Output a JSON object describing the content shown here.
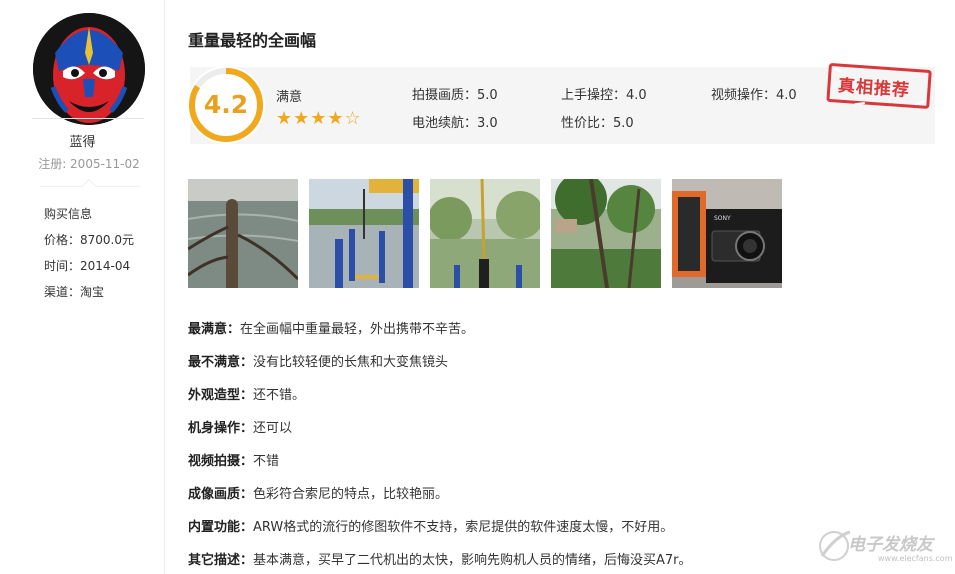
{
  "user": {
    "name": "蓝得",
    "reg_date": "注册: 2005-11-02",
    "purchase": {
      "heading": "购买信息",
      "price": "价格：8700.0元",
      "time": "时间：2014-04",
      "channel": "渠道：淘宝"
    }
  },
  "review": {
    "title": "重量最轻的全画幅",
    "score": "4.2",
    "score_value": 4.2,
    "score_max": 5,
    "satisfaction": "满意",
    "stars": "★★★★☆",
    "stars_filled": 4,
    "stars_total": 5,
    "metrics": [
      {
        "label": "拍摄画质：5.0"
      },
      {
        "label": "上手操控：4.0"
      },
      {
        "label": "视频操作：4.0"
      },
      {
        "label": "电池续航：3.0"
      },
      {
        "label": "性价比：5.0"
      }
    ],
    "stamp": "真相推荐",
    "thumbnails": [
      {
        "name": "lake-railing-photo"
      },
      {
        "name": "park-fitness-photo"
      },
      {
        "name": "swing-chain-photo"
      },
      {
        "name": "trees-park-photo"
      },
      {
        "name": "camera-box-photo",
        "text": "SONY"
      }
    ],
    "items": [
      {
        "label": "最满意：",
        "text": "在全画幅中重量最轻，外出携带不辛苦。"
      },
      {
        "label": "最不满意：",
        "text": "没有比较轻便的长焦和大变焦镜头"
      },
      {
        "label": "外观造型：",
        "text": "还不错。"
      },
      {
        "label": "机身操作：",
        "text": "还可以"
      },
      {
        "label": "视频拍摄：",
        "text": "不错"
      },
      {
        "label": "成像画质：",
        "text": "色彩符合索尼的特点，比较艳丽。"
      },
      {
        "label": "内置功能：",
        "text": "ARW格式的流行的修图软件不支持，索尼提供的软件速度太慢，不好用。"
      },
      {
        "label": "其它描述：",
        "text": "基本满意，买早了二代机出的太快，影响先购机人员的情绪，后悔没买A7r。"
      }
    ]
  },
  "watermark": {
    "text": "电子发烧友",
    "url": "www.elecfans.com"
  },
  "colors": {
    "accent": "#f0a81c",
    "stamp": "#d8383a"
  }
}
